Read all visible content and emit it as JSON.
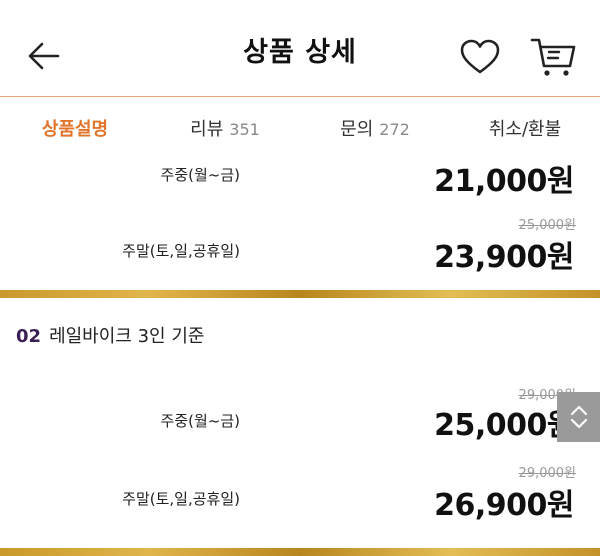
{
  "header": {
    "title": "상품 상세",
    "back_icon": "arrow-left-icon",
    "wishlist_icon": "heart-icon",
    "cart_icon": "cart-icon"
  },
  "tabs": [
    {
      "label": "상품설명",
      "count": ""
    },
    {
      "label": "리뷰",
      "count": "351"
    },
    {
      "label": "문의",
      "count": "272"
    },
    {
      "label": "취소/환불",
      "count": ""
    }
  ],
  "accent_color": "#e0752b",
  "section1": {
    "rows": [
      {
        "day": "주중(월~금)",
        "original_price": "",
        "price": "21,000원"
      },
      {
        "day": "주말(토,일,공휴일)",
        "original_price": "25,000원",
        "price": "23,900원"
      }
    ]
  },
  "section2": {
    "number": "02",
    "title": "레일바이크 3인 기준",
    "rows": [
      {
        "day": "주중(월~금)",
        "original_price": "29,000원",
        "price": "25,000원"
      },
      {
        "day": "주말(토,일,공휴일)",
        "original_price": "29,000원",
        "price": "26,900원"
      }
    ]
  }
}
